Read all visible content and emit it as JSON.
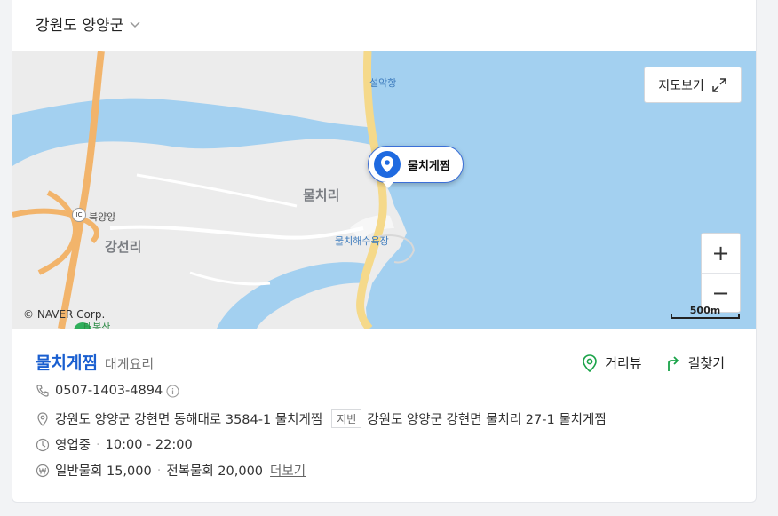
{
  "region": {
    "label": "강원도 양양군"
  },
  "map": {
    "labels": {
      "port": "설악항",
      "village": "물치리",
      "ic": "북양양",
      "district": "강선리",
      "beach": "물치해수욕장",
      "mountain": "태봉산"
    },
    "marker_label": "물치게찜",
    "view_map_label": "지도보기",
    "zoom_in": "+",
    "zoom_out": "−",
    "copyright": "© NAVER Corp.",
    "scale_label": "500m",
    "ic_badge": "IC"
  },
  "place": {
    "name": "물치게찜",
    "category": "대게요리",
    "phone": "0507-1403-4894",
    "road_address": "강원도 양양군 강현면 동해대로 3584-1 물치게찜",
    "lot_tag": "지번",
    "lot_address": "강원도 양양군 강현면 물치리 27-1 물치게찜",
    "status": "영업중",
    "hours": "10:00 - 22:00",
    "menu1": "일반물회 15,000",
    "menu2": "전복물회 20,000",
    "more_label": "더보기"
  },
  "actions": {
    "street_view": "거리뷰",
    "directions": "길찾기"
  },
  "colors": {
    "accent": "#1a5fd0",
    "sea": "#a3d0f0",
    "land": "#ececec",
    "road": "#f5d98a",
    "green": "#1aa349"
  }
}
